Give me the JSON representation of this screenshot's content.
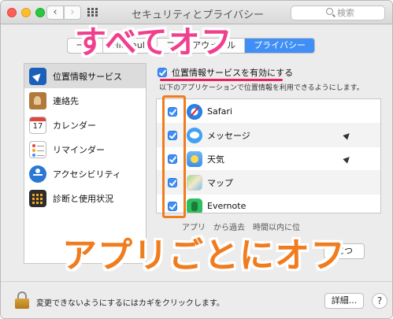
{
  "window": {
    "title": "セキュリティとプライバシー",
    "search_placeholder": "検索"
  },
  "tabs": [
    {
      "label": "一般"
    },
    {
      "label": "FileVault"
    },
    {
      "label": "ファイアウォール"
    },
    {
      "label": "プライバシー"
    }
  ],
  "annotations": {
    "top": "すべてオフ",
    "bottom": "アプリごとにオフ",
    "colors": {
      "pink": "#f0408d",
      "orange": "#f07c1e",
      "underline": "#e8205c"
    }
  },
  "sidebar": {
    "items": [
      {
        "label": "位置情報サービス",
        "icon": "location-icon"
      },
      {
        "label": "連絡先",
        "icon": "contacts-icon"
      },
      {
        "label": "カレンダー",
        "icon": "calendar-icon",
        "calendar_day": "17"
      },
      {
        "label": "リマインダー",
        "icon": "reminders-icon"
      },
      {
        "label": "アクセシビリティ",
        "icon": "accessibility-icon"
      },
      {
        "label": "診断と使用状況",
        "icon": "diagnostics-icon"
      }
    ]
  },
  "main": {
    "enable_label": "位置情報サービスを有効にする",
    "enable_checked": true,
    "description": "以下のアプリケーションで位置情報を利用できるようにします。",
    "apps": [
      {
        "name": "Safari",
        "checked": true,
        "icon": "safari-icon",
        "recent_location": false
      },
      {
        "name": "メッセージ",
        "checked": true,
        "icon": "messages-icon",
        "recent_location": true
      },
      {
        "name": "天気",
        "checked": true,
        "icon": "weather-icon",
        "recent_location": true
      },
      {
        "name": "マップ",
        "checked": true,
        "icon": "maps-icon",
        "recent_location": false
      },
      {
        "name": "Evernote",
        "checked": true,
        "icon": "evernote-icon",
        "recent_location": false
      }
    ],
    "note_line1": "アプリ　から過去　時間以内に位置情報が要求され",
    "note_line2": "　　　　",
    "detail_mid": "につ"
  },
  "bottom": {
    "lock_text": "変更できないようにするにはカギをクリックします。",
    "detail_button": "詳細...",
    "help_button": "?"
  },
  "colors": {
    "accent": "#3f8ff6",
    "close": "#ff5f57",
    "minimize": "#ffbd2e",
    "maximize": "#28c940"
  }
}
